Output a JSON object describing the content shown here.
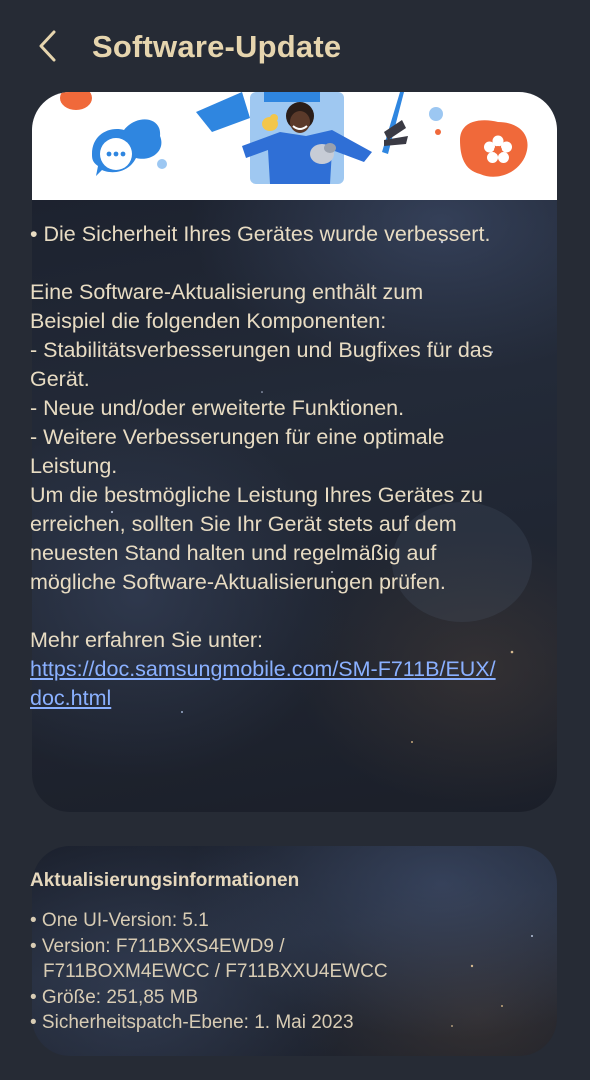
{
  "header": {
    "title": "Software-Update",
    "back_icon": "chevron-left-icon"
  },
  "banner": {
    "icons": [
      "chat-bubble-icon",
      "flower-icon",
      "person-illustration",
      "bird-icon",
      "dog-icon"
    ]
  },
  "release_notes": {
    "paragraph1": "• Die Sicherheit Ihres Gerätes wurde verbessert.",
    "intro": "Eine Software-Aktualisierung enthält zum Beispiel die folgenden Komponenten:",
    "items": [
      " - Stabilitätsverbesserungen und Bugfixes für das Gerät.",
      " - Neue und/oder erweiterte Funktionen.",
      " - Weitere Verbesserungen für eine optimale Leistung."
    ],
    "advice": "Um die bestmögliche Leistung Ihres Gerätes zu erreichen, sollten Sie Ihr Gerät stets auf dem neuesten Stand halten und regelmäßig auf mögliche Software-Aktualisierungen prüfen.",
    "more_label": "Mehr erfahren Sie unter:",
    "link": "https://doc.samsungmobile.com/SM-F711B/EUX/doc.html"
  },
  "update_info": {
    "heading": "Aktualisierungsinformationen",
    "one_ui": "• One UI-Version: 5.1",
    "version_line1": "• Version: F711BXXS4EWD9 /",
    "version_line2": "F711BOXM4EWCC / F711BXXU4EWCC",
    "size": "• Größe: 251,85 MB",
    "security_patch": "• Sicherheitspatch-Ebene: 1. Mai 2023"
  },
  "colors": {
    "background": "#262b35",
    "title": "#e6d5ae",
    "text": "#e8dcc3",
    "link": "#8ab0ff",
    "banner_blue": "#2f86e0",
    "banner_orange": "#f0693a"
  }
}
